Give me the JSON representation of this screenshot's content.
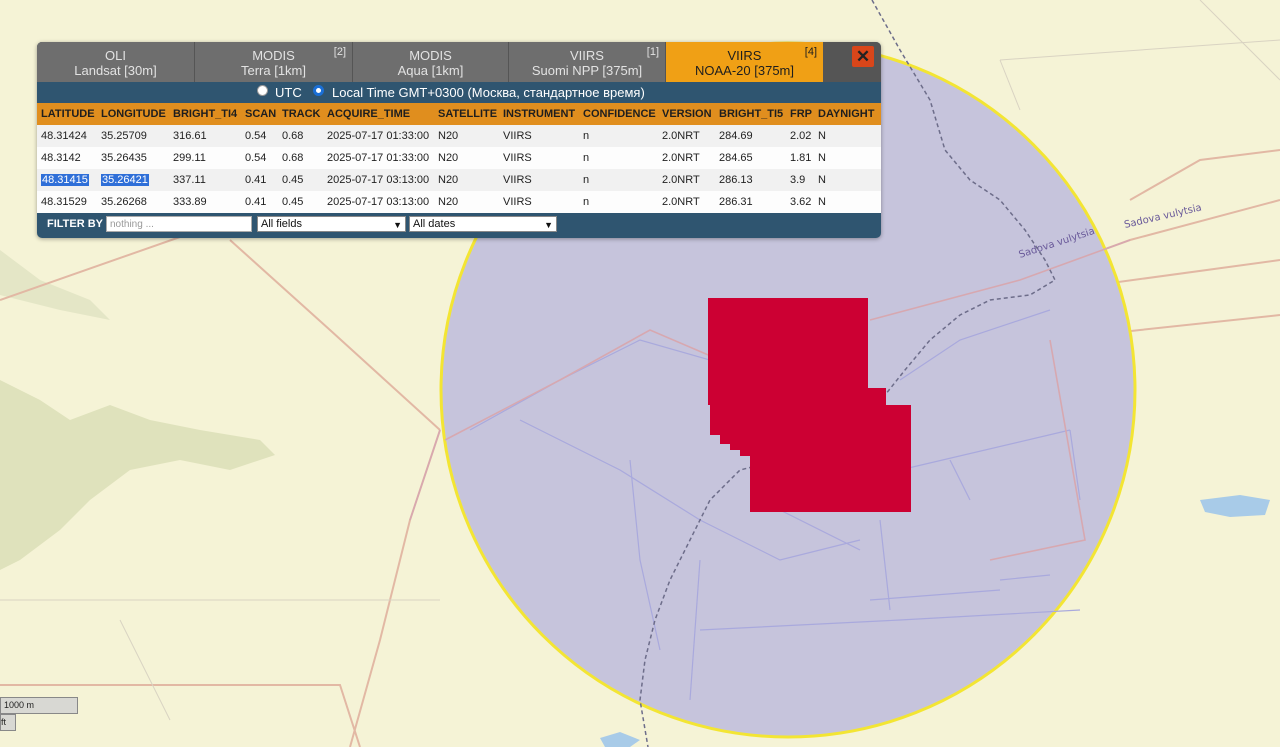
{
  "tabs": [
    {
      "line1": "OLI",
      "line2": "Landsat [30m]",
      "count": "",
      "active": false
    },
    {
      "line1": "MODIS",
      "line2": "Terra [1km]",
      "count": "[2]",
      "active": false
    },
    {
      "line1": "MODIS",
      "line2": "Aqua [1km]",
      "count": "",
      "active": false
    },
    {
      "line1": "VIIRS",
      "line2": "Suomi NPP [375m]",
      "count": "[1]",
      "active": false
    },
    {
      "line1": "VIIRS",
      "line2": "NOAA-20 [375m]",
      "count": "[4]",
      "active": true
    }
  ],
  "close_label": "✕",
  "time": {
    "utc_label": "UTC",
    "local_label": "Local Time GMT+0300 (Москва, стандартное время)",
    "selected": "local"
  },
  "table": {
    "columns": [
      "LATITUDE",
      "LONGITUDE",
      "BRIGHT_TI4",
      "SCAN",
      "TRACK",
      "ACQUIRE_TIME",
      "SATELLITE",
      "INSTRUMENT",
      "CONFIDENCE",
      "VERSION",
      "BRIGHT_TI5",
      "FRP",
      "DAYNIGHT"
    ],
    "rows": [
      [
        "48.31424",
        "35.25709",
        "316.61",
        "0.54",
        "0.68",
        "2025-07-17 01:33:00",
        "N20",
        "VIIRS",
        "n",
        "2.0NRT",
        "284.69",
        "2.02",
        "N"
      ],
      [
        "48.3142",
        "35.26435",
        "299.11",
        "0.54",
        "0.68",
        "2025-07-17 01:33:00",
        "N20",
        "VIIRS",
        "n",
        "2.0NRT",
        "284.65",
        "1.81",
        "N"
      ],
      [
        "48.31415",
        "35.26421",
        "337.11",
        "0.41",
        "0.45",
        "2025-07-17 03:13:00",
        "N20",
        "VIIRS",
        "n",
        "2.0NRT",
        "286.13",
        "3.9",
        "N"
      ],
      [
        "48.31529",
        "35.26268",
        "333.89",
        "0.41",
        "0.45",
        "2025-07-17 03:13:00",
        "N20",
        "VIIRS",
        "n",
        "2.0NRT",
        "286.31",
        "3.62",
        "N"
      ]
    ],
    "highlighted_row": 2
  },
  "filter": {
    "label": "FILTER BY",
    "placeholder": "nothing ...",
    "field_select": "All fields",
    "date_select": "All dates"
  },
  "map": {
    "road_labels": [
      "Sadova vulytsia",
      "Sadova vulytsia"
    ],
    "scale_label": "1000 m",
    "scale_label_2": "ft",
    "colors": {
      "background": "#f5f3d6",
      "search_circle_fill": "#c6c4dc",
      "search_circle_border": "#f3e533",
      "fire_pixel": "#cc0033",
      "road": "#e2b8a4",
      "water": "#a8cbe8"
    }
  }
}
